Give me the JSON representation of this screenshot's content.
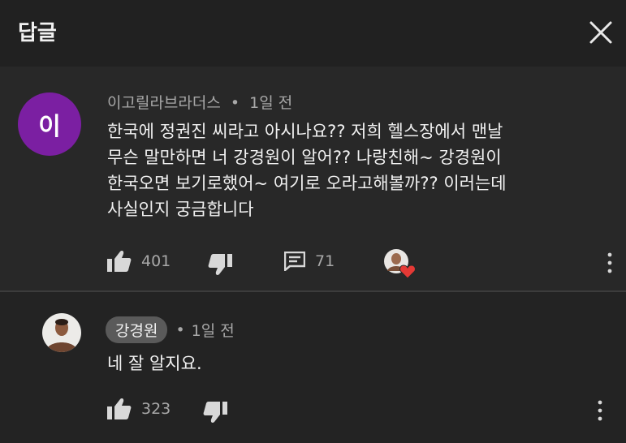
{
  "header": {
    "title": "답글"
  },
  "parent_comment": {
    "avatar_letter": "이",
    "avatar_color": "#7b1fa2",
    "author": "이고릴라브라더스",
    "separator": "•",
    "time": "1일 전",
    "text_lines": [
      "한국에 정권진 씨라고 아시나요?? 저희 헬스장에서 맨날",
      "무슨 말만하면 너 강경원이 알어?? 나랑친해~ 강경원이",
      "한국오면 보기로했어~  여기로 오라고해볼까?? 이러는데",
      "사실인지 궁금합니다"
    ],
    "likes": "401",
    "replies": "71"
  },
  "reply": {
    "author": "강경원",
    "separator": "•",
    "time": "1일 전",
    "text": "네 잘 알지요.",
    "likes": "323"
  },
  "icons": {
    "close": "close-icon",
    "like": "thumbs-up-icon",
    "dislike": "thumbs-down-icon",
    "reply": "comment-icon",
    "more": "more-vertical-icon",
    "creator_heart": "heart-icon"
  },
  "colors": {
    "background": "#282828",
    "header": "#212121",
    "reply_background": "#232323",
    "heart": "#e53935"
  }
}
